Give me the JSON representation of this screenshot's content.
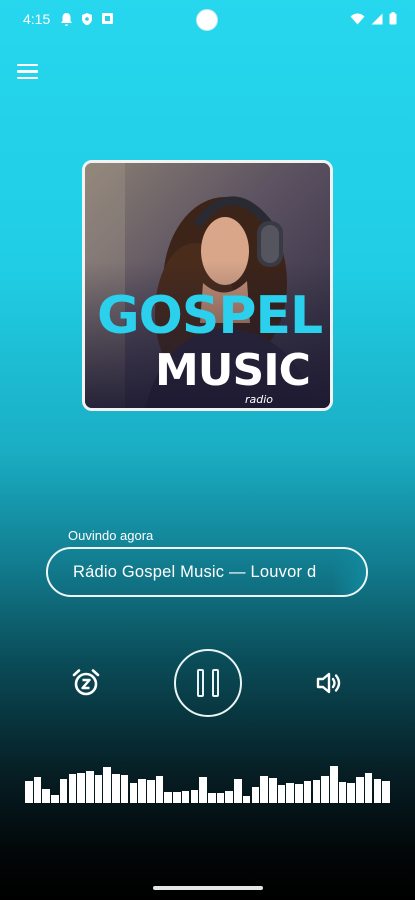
{
  "status_bar": {
    "time": "4:15",
    "left_icons": [
      "bell-icon",
      "shield-icon",
      "square-app-icon"
    ],
    "right_icons": [
      "wifi-icon",
      "cell-signal-icon",
      "battery-icon"
    ]
  },
  "artwork": {
    "logo_line1": "GOSPEL",
    "logo_line2": "MUSIC",
    "logo_line3": "radio"
  },
  "player": {
    "now_playing_label": "Ouvindo agora",
    "track_title": "Rádio Gospel Music — Louvor d",
    "state": "playing",
    "buttons": {
      "left": "alarm-timer-icon",
      "center": "pause-icon",
      "right": "volume-icon"
    }
  },
  "visualizer": {
    "levels": [
      0.48,
      0.56,
      0.3,
      0.18,
      0.52,
      0.62,
      0.66,
      0.7,
      0.6,
      0.78,
      0.62,
      0.6,
      0.44,
      0.52,
      0.5,
      0.58,
      0.24,
      0.24,
      0.26,
      0.28,
      0.56,
      0.22,
      0.22,
      0.26,
      0.52,
      0.16,
      0.34,
      0.58,
      0.54,
      0.4,
      0.44,
      0.42,
      0.48,
      0.5,
      0.58,
      0.8,
      0.46,
      0.44,
      0.56,
      0.66,
      0.52,
      0.48
    ]
  },
  "colors": {
    "accent_top": "#26d7ee",
    "accent_mid": "#127f92",
    "bottom": "#000000",
    "foreground": "#ffffff"
  }
}
